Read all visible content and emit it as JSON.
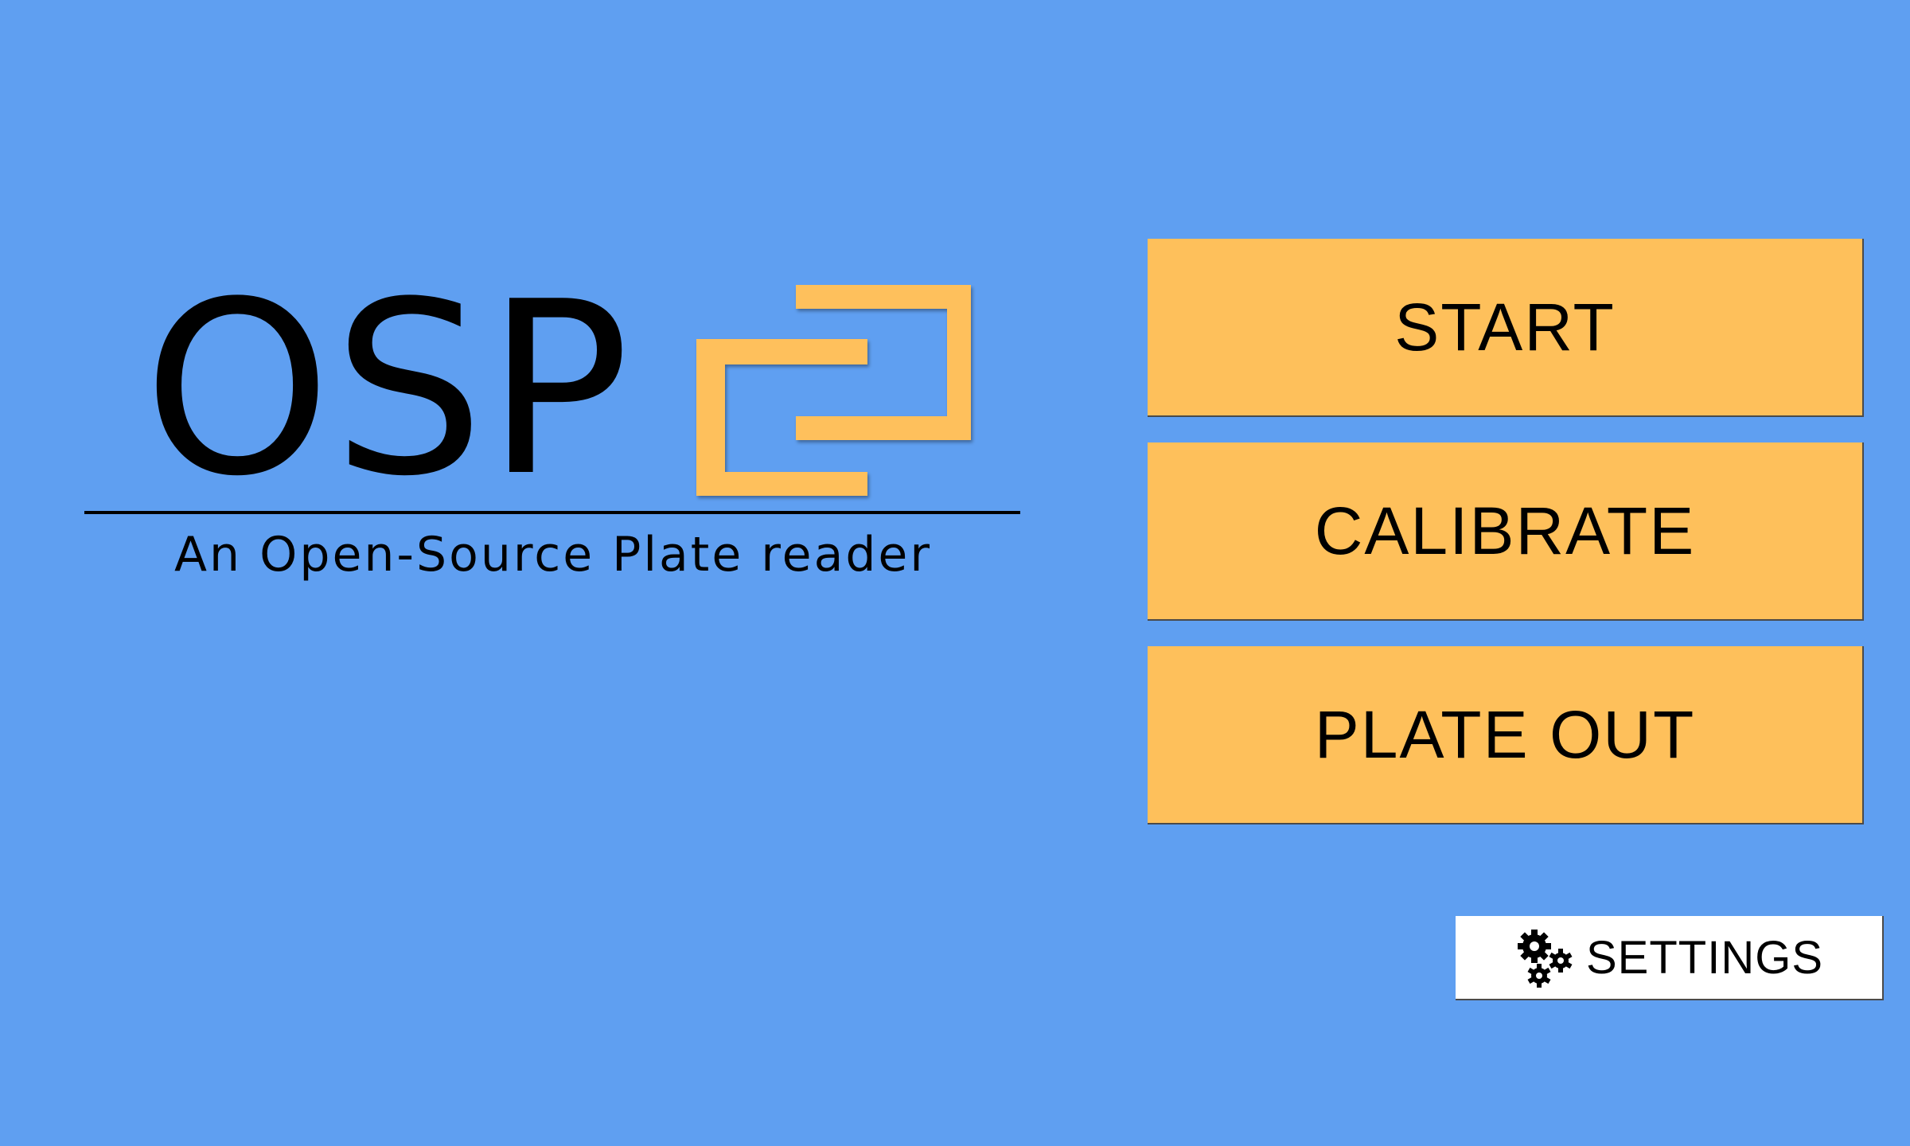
{
  "colors": {
    "background": "#5f9ff1",
    "button_fill": "#fec05b",
    "settings_fill": "#ffffff",
    "logo_accent": "#fec05b"
  },
  "logo": {
    "title": "OSP",
    "tagline": "An Open-Source Plate reader"
  },
  "buttons": {
    "start": "START",
    "calibrate": "CALIBRATE",
    "plate_out": "PLATE OUT"
  },
  "settings": {
    "label": "SETTINGS",
    "icon": "gears-icon"
  }
}
